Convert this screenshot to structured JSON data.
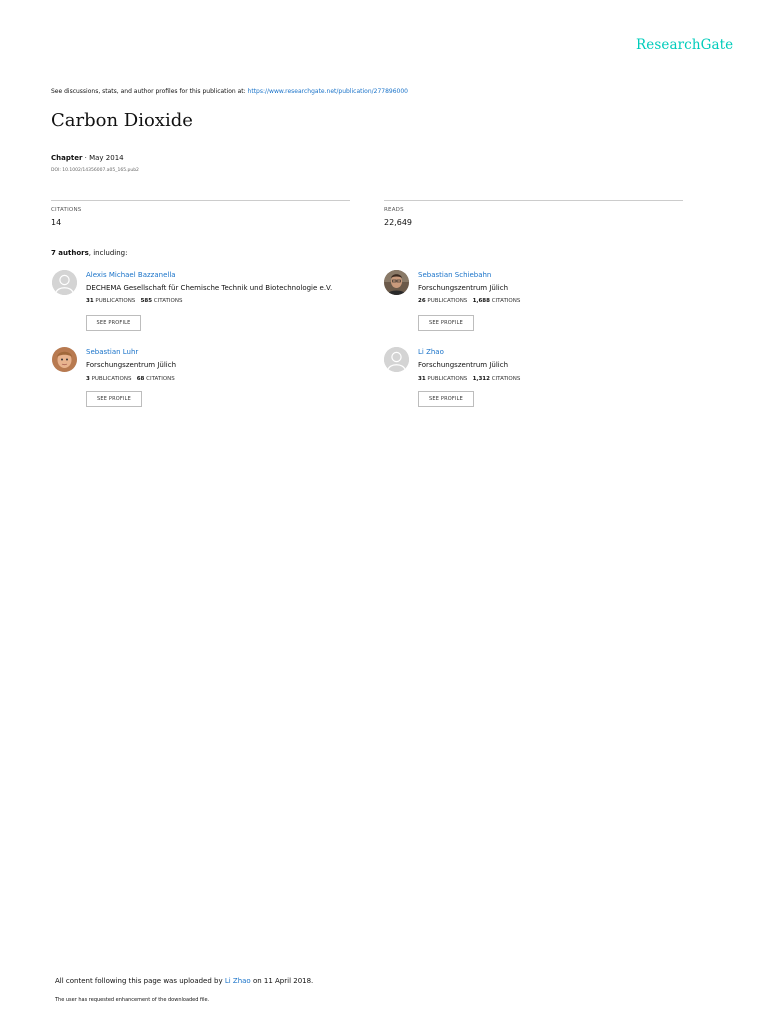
{
  "brand": "ResearchGate",
  "header": {
    "discuss_text": "See discussions, stats, and author profiles for this publication at: ",
    "discuss_link": "https://www.researchgate.net/publication/277896000"
  },
  "publication": {
    "title": "Carbon Dioxide",
    "type": "Chapter",
    "date": "May 2014",
    "doi": "DOI: 10.1002/14356007.a05_165.pub2"
  },
  "stats": {
    "citations_label": "CITATIONS",
    "citations_value": "14",
    "reads_label": "READS",
    "reads_value": "22,649"
  },
  "authors_header": {
    "count": "7 authors",
    "suffix": ", including:"
  },
  "authors": [
    {
      "name": "Alexis Michael Bazzanella",
      "institution": "DECHEMA Gesellschaft für Chemische Technik und Biotechnologie e.V.",
      "publications": "31",
      "publications_label": "PUBLICATIONS",
      "citations": "585",
      "citations_label": "CITATIONS",
      "button": "SEE PROFILE",
      "avatar": "placeholder"
    },
    {
      "name": "Sebastian Schiebahn",
      "institution": "Forschungszentrum Jülich",
      "publications": "26",
      "publications_label": "PUBLICATIONS",
      "citations": "1,688",
      "citations_label": "CITATIONS",
      "button": "SEE PROFILE",
      "avatar": "photo"
    },
    {
      "name": "Sebastian Luhr",
      "institution": "Forschungszentrum Jülich",
      "publications": "3",
      "publications_label": "PUBLICATIONS",
      "citations": "68",
      "citations_label": "CITATIONS",
      "button": "SEE PROFILE",
      "avatar": "photo"
    },
    {
      "name": "Li Zhao",
      "institution": "Forschungszentrum Jülich",
      "publications": "31",
      "publications_label": "PUBLICATIONS",
      "citations": "1,312",
      "citations_label": "CITATIONS",
      "button": "SEE PROFILE",
      "avatar": "placeholder"
    }
  ],
  "footer": {
    "upload_prefix": "All content following this page was uploaded by ",
    "uploader": "Li Zhao",
    "upload_suffix": " on 11 April 2018.",
    "enhancement_note": "The user has requested enhancement of the downloaded file."
  },
  "colors": {
    "brand": "#00ccbb",
    "link": "#1a73c9"
  }
}
